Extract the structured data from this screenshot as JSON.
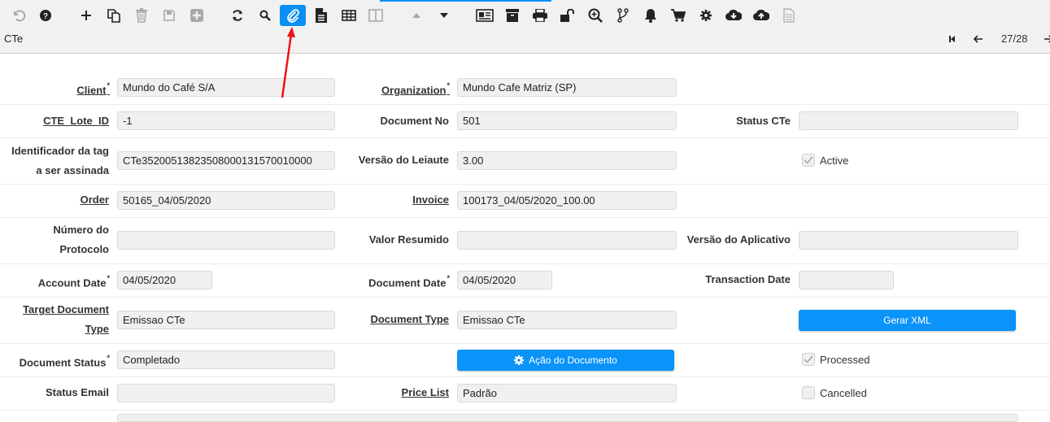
{
  "window": {
    "title": "CTe",
    "record_count": "27/28"
  },
  "toolbar": {
    "icons": [
      {
        "name": "undo-icon",
        "state": "disabled"
      },
      {
        "name": "help-icon",
        "state": "normal"
      },
      {
        "name": "new-record-icon",
        "state": "normal"
      },
      {
        "name": "copy-record-icon",
        "state": "normal"
      },
      {
        "name": "delete-icon",
        "state": "disabled"
      },
      {
        "name": "save-icon",
        "state": "disabled"
      },
      {
        "name": "save-and-new-icon",
        "state": "disabled"
      },
      {
        "name": "refresh-icon",
        "state": "normal"
      },
      {
        "name": "find-icon",
        "state": "normal"
      },
      {
        "name": "attachment-icon",
        "state": "active"
      },
      {
        "name": "notes-icon",
        "state": "normal"
      },
      {
        "name": "grid-toggle-icon",
        "state": "normal"
      },
      {
        "name": "split-view-icon",
        "state": "disabled"
      },
      {
        "name": "previous-parent-icon",
        "state": "disabled"
      },
      {
        "name": "next-detail-icon",
        "state": "normal"
      },
      {
        "name": "report-icon",
        "state": "normal"
      },
      {
        "name": "archive-icon",
        "state": "normal"
      },
      {
        "name": "print-icon",
        "state": "normal"
      },
      {
        "name": "lock-icon",
        "state": "normal"
      },
      {
        "name": "zoom-across-icon",
        "state": "normal"
      },
      {
        "name": "workflow-icon",
        "state": "normal"
      },
      {
        "name": "requests-icon",
        "state": "normal"
      },
      {
        "name": "product-info-icon",
        "state": "normal"
      },
      {
        "name": "process-icon",
        "state": "normal"
      },
      {
        "name": "export-icon",
        "state": "normal"
      },
      {
        "name": "import-icon",
        "state": "normal"
      },
      {
        "name": "post-it-icon",
        "state": "disabled"
      }
    ],
    "accent": "#0a8ff5"
  },
  "navigation": {
    "first": "first-record-icon",
    "previous": "previous-record-icon",
    "next": "next-record-icon"
  },
  "form": {
    "client": {
      "label": "Client",
      "required": "*",
      "value": "Mundo do Café S/A"
    },
    "organization": {
      "label": "Organization",
      "required": "*",
      "value": "Mundo Cafe Matriz (SP)"
    },
    "cte_lote_id": {
      "label": "CTE_Lote_ID",
      "value": "-1"
    },
    "document_no": {
      "label": "Document No",
      "value": "501"
    },
    "status_cte": {
      "label": "Status CTe",
      "value": ""
    },
    "identificador_line1": "Identificador da tag",
    "identificador_line2": "a ser assinada",
    "identificador_value": "CTe35200513823508000131570010000",
    "versao_leiaute": {
      "label": "Versão do Leiaute",
      "value": "3.00"
    },
    "active": {
      "label": "Active",
      "checked": true
    },
    "order": {
      "label": "Order",
      "value": "50165_04/05/2020"
    },
    "invoice": {
      "label": "Invoice",
      "value": "100173_04/05/2020_100.00"
    },
    "numero_protocolo_line1": "Número do",
    "numero_protocolo_line2": "Protocolo",
    "numero_protocolo_value": "",
    "valor_resumido": {
      "label": "Valor Resumido",
      "value": ""
    },
    "versao_aplicativo": {
      "label": "Versão do Aplicativo",
      "value": ""
    },
    "account_date": {
      "label": "Account Date",
      "required": "*",
      "value": "04/05/2020"
    },
    "document_date": {
      "label": "Document Date",
      "required": "*",
      "value": "04/05/2020"
    },
    "transaction_date": {
      "label": "Transaction Date",
      "value": ""
    },
    "target_doc_type_line1": "Target Document",
    "target_doc_type_line2": "Type",
    "target_doc_type_value": "Emissao CTe",
    "document_type": {
      "label": "Document Type",
      "value": "Emissao CTe"
    },
    "gerar_xml": {
      "label": "Gerar XML"
    },
    "document_status": {
      "label": "Document Status",
      "required": "*",
      "value": "Completado"
    },
    "acao_documento": {
      "label": "Ação do Documento"
    },
    "processed": {
      "label": "Processed",
      "checked": true
    },
    "status_email": {
      "label": "Status Email",
      "value": ""
    },
    "price_list": {
      "label": "Price List",
      "value": "Padrão"
    },
    "cancelled": {
      "label": "Cancelled",
      "checked": false
    }
  },
  "annotation": {
    "type": "red-arrow",
    "points_to": "attachment-icon",
    "color": "#ee1111"
  }
}
